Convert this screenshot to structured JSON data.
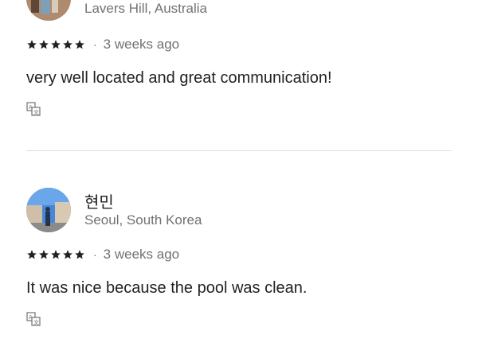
{
  "reviews": [
    {
      "location": "Lavers Hill, Australia",
      "rating": 5,
      "date": "3 weeks ago",
      "text": "very well located and great communication!"
    },
    {
      "name": "현민",
      "location": "Seoul, South Korea",
      "rating": 5,
      "date": "3 weeks ago",
      "text": "It was nice because the pool was clean."
    }
  ],
  "icons": {
    "rating": "star-icon",
    "translate": "translate-icon"
  }
}
